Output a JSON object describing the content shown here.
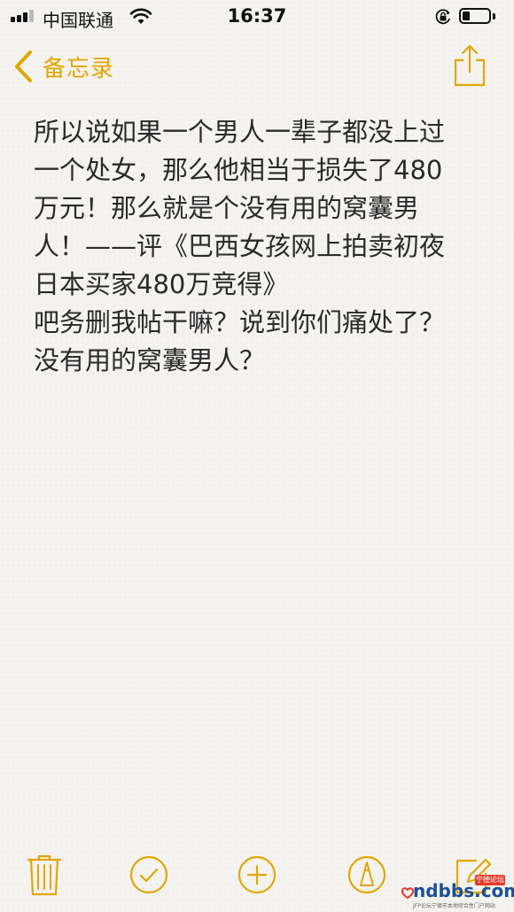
{
  "status_bar": {
    "carrier": "中国联通",
    "time": "16:37"
  },
  "nav": {
    "back_label": "备忘录",
    "back_icon": "chevron-left-icon",
    "share_icon": "share-icon"
  },
  "note": {
    "lines": [
      "所以说如果一个男人一辈子都没上过",
      "一个处女，那么他相当于损失了480",
      "万元！那么就是个没有用的窝囊男",
      "人！——评《巴西女孩网上拍卖初夜",
      "日本买家480万竞得》",
      "吧务删我帖干嘛？说到你们痛处了？",
      "没有用的窝囊男人？"
    ]
  },
  "toolbar": {
    "icons": [
      "trash-icon",
      "checklist-icon",
      "add-icon",
      "sketch-icon",
      "compose-icon"
    ]
  },
  "watermark": {
    "domain": "ndbbs.com",
    "badge": "宁德论坛",
    "sub": "JFP论坛宁德市本地综合性门户网站"
  },
  "colors": {
    "accent": "#e2a600",
    "text": "#2a2a2a",
    "background": "#f4f3f0"
  }
}
